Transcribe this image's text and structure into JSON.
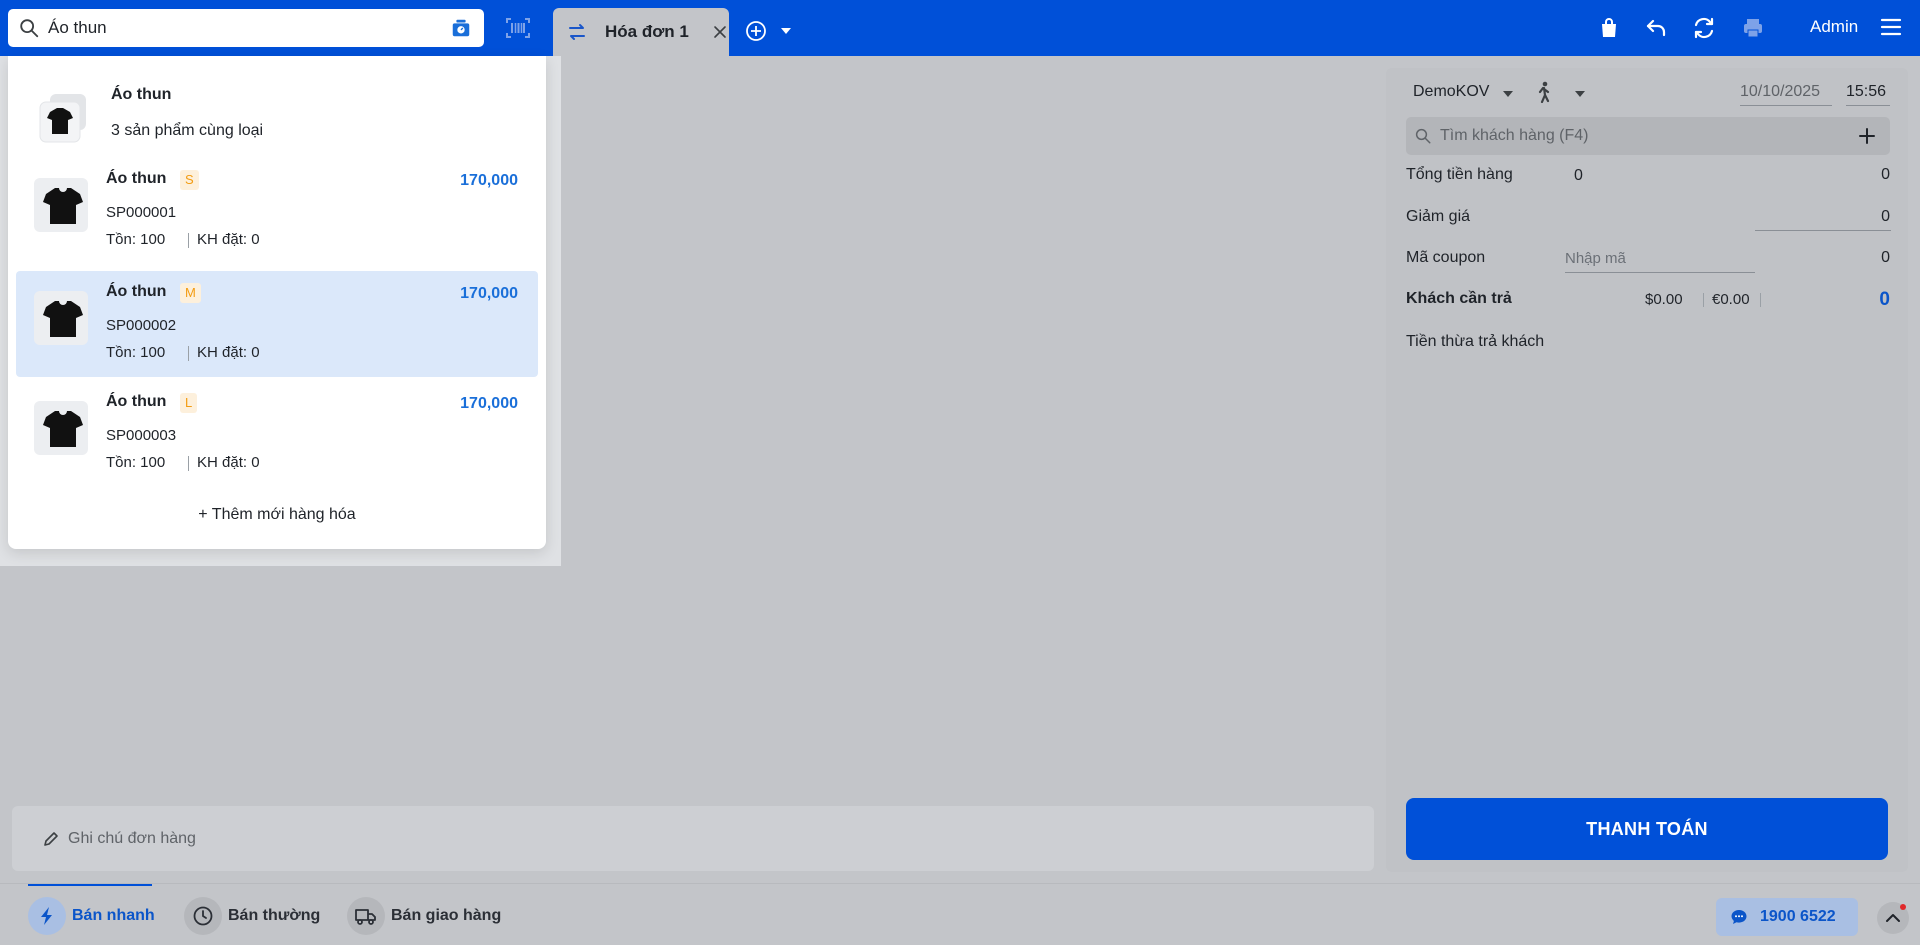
{
  "search": {
    "value": "Áo thun"
  },
  "tab": {
    "label": "Hóa đơn 1"
  },
  "header": {
    "user": "Admin"
  },
  "dropdown": {
    "group": {
      "name": "Áo thun",
      "subtitle": "3 sản phẩm cùng loại"
    },
    "products": [
      {
        "name": "Áo thun",
        "size": "S",
        "price": "170,000",
        "sku": "SP000001",
        "stock": "Tồn: 100",
        "ordered": "KH đặt: 0",
        "selected": false
      },
      {
        "name": "Áo thun",
        "size": "M",
        "price": "170,000",
        "sku": "SP000002",
        "stock": "Tồn: 100",
        "ordered": "KH đặt: 0",
        "selected": true
      },
      {
        "name": "Áo thun",
        "size": "L",
        "price": "170,000",
        "sku": "SP000003",
        "stock": "Tồn: 100",
        "ordered": "KH đặt: 0",
        "selected": false
      }
    ],
    "add_new": "+ Thêm mới hàng hóa"
  },
  "right_panel": {
    "seller": "DemoKOV",
    "date": "10/10/2025",
    "time": "15:56",
    "customer_placeholder": "Tìm khách hàng (F4)",
    "total_label": "Tổng tiền hàng",
    "total_qty": "0",
    "total_value": "0",
    "discount_label": "Giảm giá",
    "discount_value": "0",
    "coupon_label": "Mã coupon",
    "coupon_placeholder": "Nhập mã",
    "coupon_value": "0",
    "customer_pay_label": "Khách cần trả",
    "usd": "$0.00",
    "eur": "€0.00",
    "customer_pay_value": "0",
    "change_label": "Tiền thừa trả khách",
    "pay_button": "THANH TOÁN",
    "colors": {
      "primary": "#0050d8",
      "price": "#1a6fd9"
    }
  },
  "note": {
    "placeholder": "Ghi chú đơn hàng"
  },
  "bottom": {
    "modes": [
      {
        "label": "Bán nhanh",
        "icon": "bolt-icon",
        "active": true
      },
      {
        "label": "Bán thường",
        "icon": "clock-icon",
        "active": false
      },
      {
        "label": "Bán giao hàng",
        "icon": "truck-icon",
        "active": false
      }
    ],
    "hotline": "1900 6522"
  }
}
